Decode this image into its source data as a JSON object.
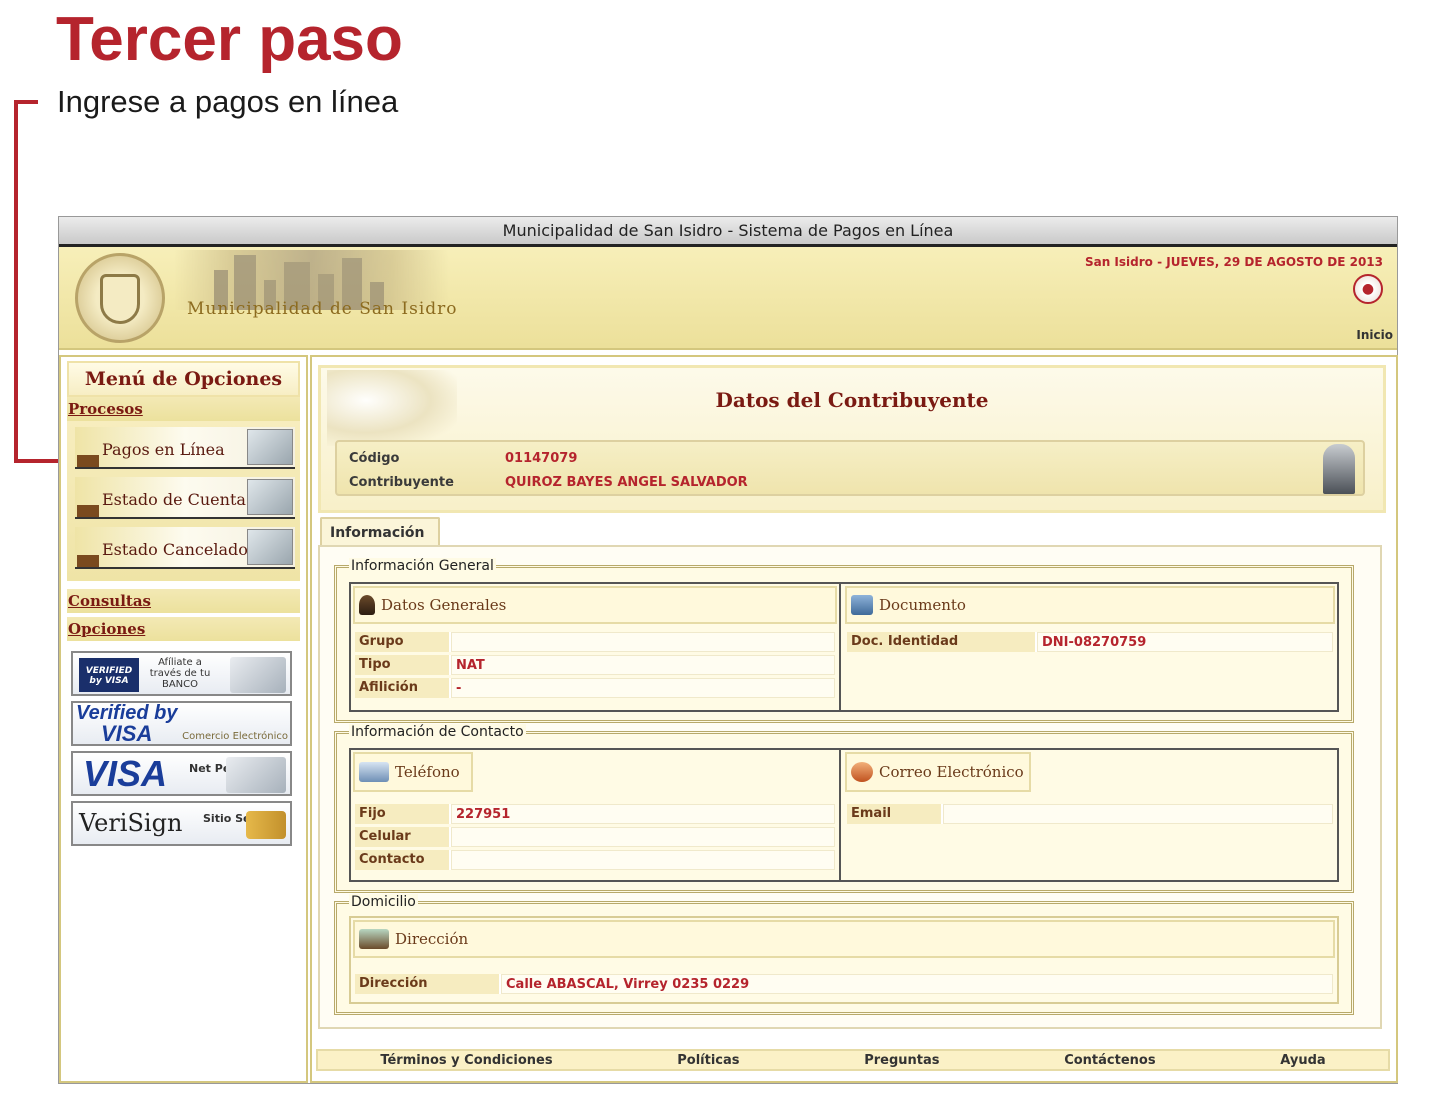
{
  "step": {
    "title": "Tercer paso",
    "subtitle": "Ingrese a pagos en línea"
  },
  "window": {
    "title": "Municipalidad de San Isidro - Sistema de Pagos en Línea"
  },
  "banner": {
    "name": "Municipalidad de San Isidro",
    "date": "San Isidro - JUEVES, 29 DE AGOSTO DE 2013",
    "home_link": "Inicio"
  },
  "sidebar": {
    "menu_title": "Menú de Opciones",
    "procesos": "Procesos",
    "items": [
      {
        "label": "Pagos en Línea"
      },
      {
        "label": "Estado de Cuenta"
      },
      {
        "label": "Estado Cancelado"
      }
    ],
    "consultas": "Consultas",
    "opciones": "Opciones",
    "badges": {
      "verified_small": "VERIFIED by VISA",
      "afiliate": "Afíliate a través de tu BANCO",
      "vbv_top": "Verified by",
      "vbv_bottom": "VISA",
      "vbv_sub": "Comercio Electrónico",
      "visa": "VISA",
      "visa_right": "Net Perú",
      "verisign": "VeriSign",
      "verisign_right": "Sitio Seguro"
    }
  },
  "header": {
    "title": "Datos del Contribuyente",
    "codigo_label": "Código",
    "codigo_value": "01147079",
    "contribuyente_label": "Contribuyente",
    "contribuyente_value": "QUIROZ BAYES ANGEL SALVADOR"
  },
  "tab": {
    "label": "Información"
  },
  "general": {
    "legend": "Información General",
    "datos_head": "Datos Generales",
    "documento_head": "Documento",
    "grupo_label": "Grupo",
    "grupo_value": "",
    "tipo_label": "Tipo",
    "tipo_value": "NAT",
    "afiliacion_label": "Afilición",
    "afiliacion_value": "-",
    "doc_label": "Doc. Identidad",
    "doc_value": "DNI-08270759"
  },
  "contacto": {
    "legend": "Información de Contacto",
    "telefono_head": "Teléfono",
    "correo_head": "Correo Electrónico",
    "fijo_label": "Fijo",
    "fijo_value": "227951",
    "celular_label": "Celular",
    "celular_value": "",
    "contacto_label": "Contacto",
    "contacto_value": "",
    "email_label": "Email",
    "email_value": ""
  },
  "domicilio": {
    "legend": "Domicilio",
    "direccion_head": "Dirección",
    "direccion_label": "Dirección",
    "direccion_value": "Calle ABASCAL, Virrey 0235 0229"
  },
  "footer": {
    "terminos": "Términos y Condiciones",
    "politicas": "Políticas",
    "preguntas": "Preguntas",
    "contactenos": "Contáctenos",
    "ayuda": "Ayuda"
  },
  "colors": {
    "accent": "#b5242d",
    "panel": "#f7eec4"
  }
}
